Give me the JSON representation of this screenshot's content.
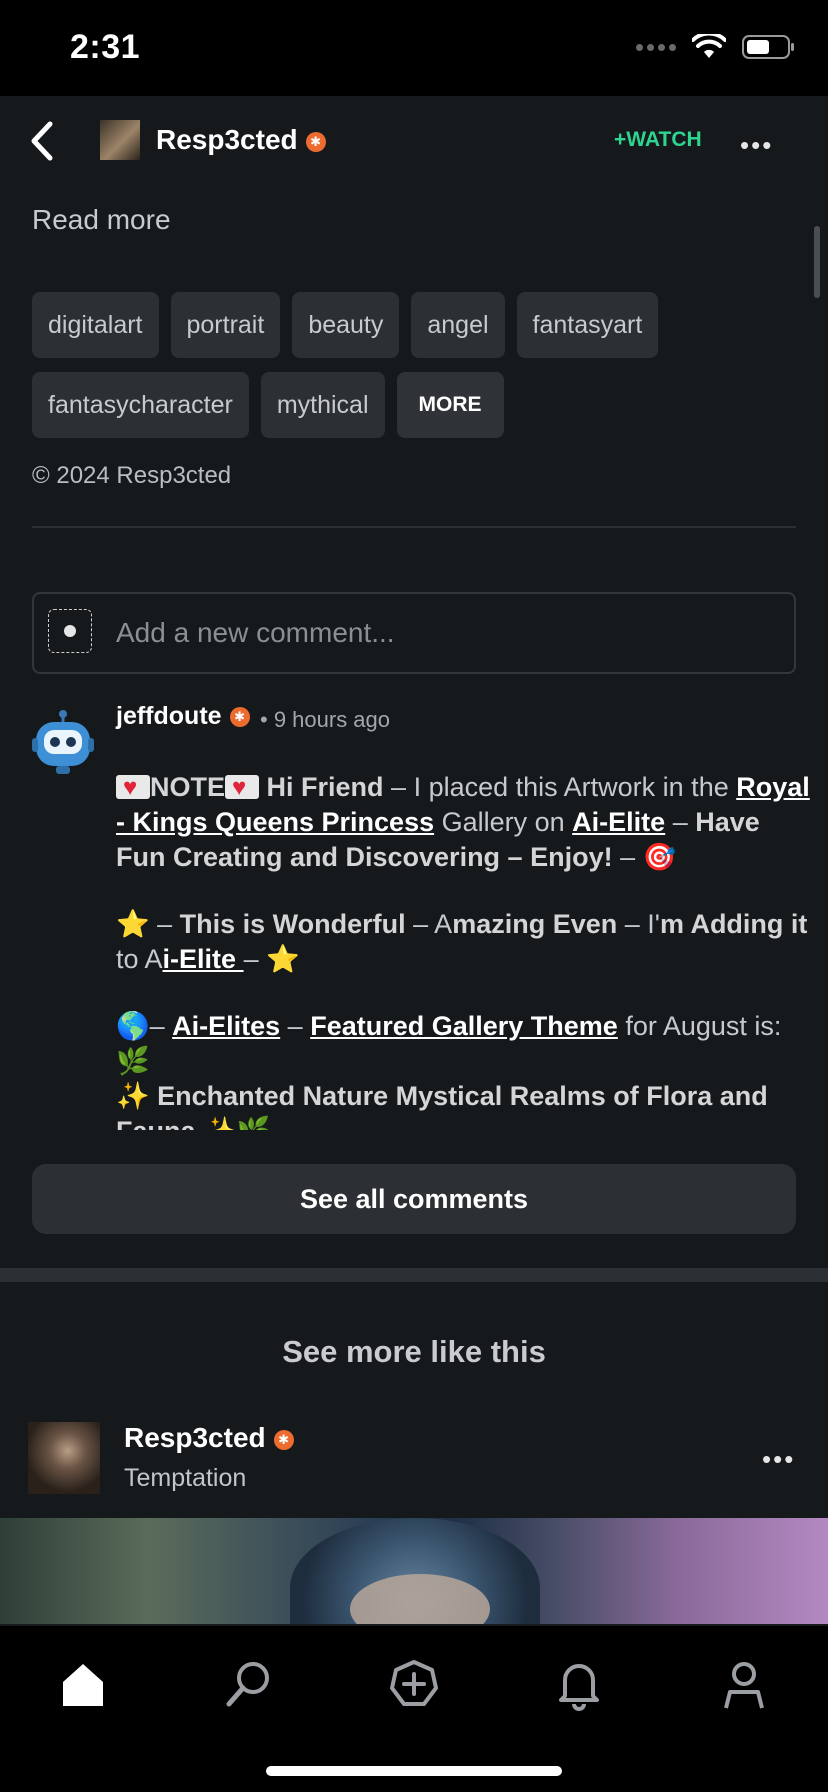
{
  "status_bar": {
    "time": "2:31"
  },
  "header": {
    "artist_name": "Resp3cted",
    "watch_label": "+WATCH",
    "more_label": "•••"
  },
  "description": {
    "read_more": "Read more"
  },
  "tags": [
    "digitalart",
    "portrait",
    "beauty",
    "angel",
    "fantasyart",
    "fantasycharacter",
    "mythical"
  ],
  "tags_more_label": "MORE",
  "copyright": "© 2024 Resp3cted",
  "comment_input": {
    "placeholder": "Add a new comment..."
  },
  "comment": {
    "username": "jeffdoute",
    "time": "• 9 hours ago",
    "p1": {
      "note": "NOTE",
      "greeting": "Hi Friend",
      "t1": " – I placed this Artwork in the ",
      "gallery_link": "Royal - Kings Queens Princess",
      "t2": " Gallery on ",
      "site_link": "Ai-Elite",
      "t3": " – ",
      "closing": "Have Fun Creating and Discovering – Enjoy!",
      "t4": " – 🎯"
    },
    "p2": {
      "t1": "⭐ – ",
      "b1": "This is Wonderful",
      "t2": " – A",
      "b2": "mazing Even",
      "t3": " – I'",
      "b3": "m Adding it",
      "t4": " to A",
      "link": "i-Elite ",
      "t5": " – ⭐"
    },
    "p3": {
      "t1": "🌎– ",
      "link1": "Ai-Elites",
      "t2": " – ",
      "link2": "Featured Gallery Theme",
      "t3": " for August is: 🌿",
      "line2": "✨ Enchanted Nature Mystical Realms of Flora and Fauna ✨🌿"
    }
  },
  "see_all_comments": "See all comments",
  "see_more_like_this": "See more like this",
  "related": {
    "artist_name": "Resp3cted",
    "title": "Temptation",
    "more_label": "•••"
  },
  "tabbar": {
    "icons": [
      "home-icon",
      "search-icon",
      "create-icon",
      "bell-icon",
      "profile-icon"
    ]
  },
  "colors": {
    "accent_green": "#2ed58f",
    "badge_orange": "#ec6b2e",
    "background": "#16191c"
  }
}
